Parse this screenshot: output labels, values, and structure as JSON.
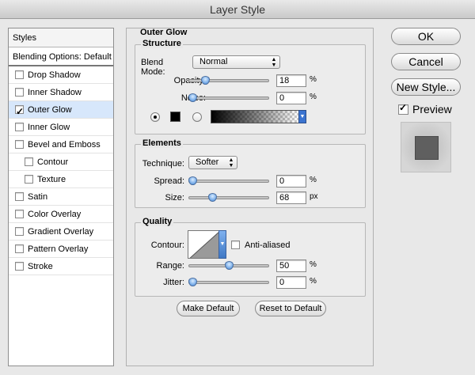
{
  "window": {
    "title": "Layer Style"
  },
  "styles_panel": {
    "header": "Styles",
    "blending_default": "Blending Options: Default",
    "items": [
      {
        "label": "Drop Shadow",
        "checked": false,
        "sub": false,
        "selected": false
      },
      {
        "label": "Inner Shadow",
        "checked": false,
        "sub": false,
        "selected": false
      },
      {
        "label": "Outer Glow",
        "checked": true,
        "sub": false,
        "selected": true
      },
      {
        "label": "Inner Glow",
        "checked": false,
        "sub": false,
        "selected": false
      },
      {
        "label": "Bevel and Emboss",
        "checked": false,
        "sub": false,
        "selected": false
      },
      {
        "label": "Contour",
        "checked": false,
        "sub": true,
        "selected": false
      },
      {
        "label": "Texture",
        "checked": false,
        "sub": true,
        "selected": false
      },
      {
        "label": "Satin",
        "checked": false,
        "sub": false,
        "selected": false
      },
      {
        "label": "Color Overlay",
        "checked": false,
        "sub": false,
        "selected": false
      },
      {
        "label": "Gradient Overlay",
        "checked": false,
        "sub": false,
        "selected": false
      },
      {
        "label": "Pattern Overlay",
        "checked": false,
        "sub": false,
        "selected": false
      },
      {
        "label": "Stroke",
        "checked": false,
        "sub": false,
        "selected": false
      }
    ]
  },
  "outer_glow": {
    "title": "Outer Glow",
    "structure": {
      "title": "Structure",
      "blend_mode_label": "Blend Mode:",
      "blend_mode_value": "Normal",
      "opacity_label": "Opacity:",
      "opacity_value": "18",
      "opacity_fraction": 0.18,
      "opacity_unit": "%",
      "noise_label": "Noise:",
      "noise_value": "0",
      "noise_fraction": 0.0,
      "noise_unit": "%",
      "color_mode": "solid",
      "glow_color": "#000000"
    },
    "elements": {
      "title": "Elements",
      "technique_label": "Technique:",
      "technique_value": "Softer",
      "spread_label": "Spread:",
      "spread_value": "0",
      "spread_fraction": 0.0,
      "spread_unit": "%",
      "size_label": "Size:",
      "size_value": "68",
      "size_fraction": 0.27,
      "size_unit": "px"
    },
    "quality": {
      "title": "Quality",
      "contour_label": "Contour:",
      "anti_aliased_label": "Anti-aliased",
      "anti_aliased_checked": false,
      "range_label": "Range:",
      "range_value": "50",
      "range_fraction": 0.5,
      "range_unit": "%",
      "jitter_label": "Jitter:",
      "jitter_value": "0",
      "jitter_fraction": 0.0,
      "jitter_unit": "%"
    },
    "make_default": "Make Default",
    "reset_default": "Reset to Default"
  },
  "actions": {
    "ok": "OK",
    "cancel": "Cancel",
    "new_style": "New Style...",
    "preview_label": "Preview",
    "preview_checked": true
  },
  "colors": {
    "selection_bg": "#d7e7fb",
    "slider_thumb": "#6ea6e6",
    "preview_swatch": "#5f5f5f"
  }
}
